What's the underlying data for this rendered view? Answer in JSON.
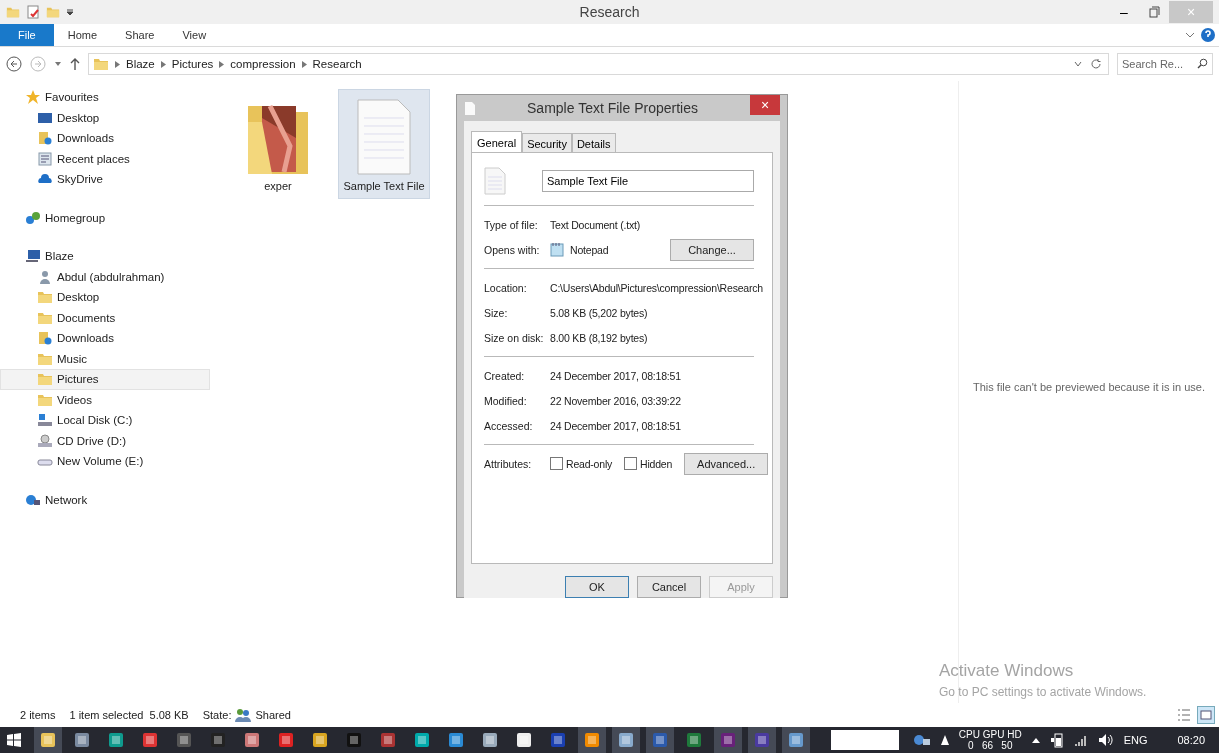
{
  "window": {
    "title": "Research",
    "controls": [
      "–",
      "×"
    ]
  },
  "ribbon": {
    "tabs": [
      {
        "label": "File",
        "selected": true
      },
      {
        "label": "Home",
        "selected": false
      },
      {
        "label": "Share",
        "selected": false
      },
      {
        "label": "View",
        "selected": false
      }
    ]
  },
  "address_bar": {
    "path": [
      "Blaze",
      "Pictures",
      "compression",
      "Research"
    ],
    "search": {
      "placeholder": "Search Re..."
    }
  },
  "sidebar": {
    "items": [
      {
        "label": "Favourites",
        "kind": "star",
        "selected": false,
        "children": [
          {
            "label": "Desktop",
            "kind": "desktop",
            "selected": false
          },
          {
            "label": "Downloads",
            "kind": "downloads",
            "selected": false
          },
          {
            "label": "Recent places",
            "kind": "recent",
            "selected": false
          },
          {
            "label": "SkyDrive",
            "kind": "cloud",
            "selected": false
          }
        ]
      },
      {
        "label": "Homegroup",
        "kind": "homegroup",
        "selected": false
      },
      {
        "label": "Blaze",
        "kind": "computer",
        "selected": false,
        "children": [
          {
            "label": "Abdul (abdulrahman)",
            "kind": "user",
            "selected": false
          },
          {
            "label": "Desktop",
            "kind": "folder",
            "selected": false
          },
          {
            "label": "Documents",
            "kind": "folder",
            "selected": false
          },
          {
            "label": "Downloads",
            "kind": "downloads",
            "selected": false
          },
          {
            "label": "Music",
            "kind": "folder",
            "selected": false
          },
          {
            "label": "Pictures",
            "kind": "folder",
            "selected": true
          },
          {
            "label": "Videos",
            "kind": "folder",
            "selected": false
          },
          {
            "label": "Local Disk (C:)",
            "kind": "disk",
            "selected": false
          },
          {
            "label": "CD Drive (D:)",
            "kind": "cd",
            "selected": false
          },
          {
            "label": "New Volume (E:)",
            "kind": "drive",
            "selected": false
          }
        ]
      },
      {
        "label": "Network",
        "kind": "network",
        "selected": false
      }
    ]
  },
  "files": [
    {
      "name": "exper",
      "kind": "folder",
      "selected": false
    },
    {
      "name": "Sample Text File",
      "kind": "text",
      "selected": true
    }
  ],
  "preview": {
    "message": "This file can't be previewed because it is in use."
  },
  "dialog": {
    "title": "Sample Text File Properties",
    "close": "×",
    "tabs": [
      {
        "label": "General",
        "selected": true
      },
      {
        "label": "Security",
        "selected": false
      },
      {
        "label": "Details",
        "selected": false
      }
    ],
    "name": "Sample Text File",
    "sections": [
      [
        {
          "label": "Type of file:",
          "kind": "text",
          "value": "Text Document (.txt)"
        },
        {
          "label": "Opens with:",
          "kind": "app",
          "value": "Notepad",
          "button": "Change..."
        }
      ],
      [
        {
          "label": "Location:",
          "kind": "text",
          "value": "C:\\Users\\Abdul\\Pictures\\compression\\Research"
        },
        {
          "label": "Size:",
          "kind": "text",
          "value": "5.08 KB (5,202 bytes)"
        },
        {
          "label": "Size on disk:",
          "kind": "text",
          "value": "8.00 KB (8,192 bytes)"
        }
      ],
      [
        {
          "label": "Created:",
          "kind": "text",
          "value": "24 December 2017, 08:18:51"
        },
        {
          "label": "Modified:",
          "kind": "text",
          "value": "22 November 2016, 03:39:22"
        },
        {
          "label": "Accessed:",
          "kind": "text",
          "value": "24 December 2017, 08:18:51"
        }
      ],
      [
        {
          "label": "Attributes:",
          "kind": "attributes",
          "checkboxes": [
            {
              "label": "Read-only",
              "checked": false
            },
            {
              "label": "Hidden",
              "checked": false
            }
          ],
          "button": "Advanced..."
        }
      ]
    ],
    "buttons": [
      {
        "label": "OK",
        "disabled": false,
        "default": true
      },
      {
        "label": "Cancel",
        "disabled": false,
        "default": false
      },
      {
        "label": "Apply",
        "disabled": true,
        "default": false
      }
    ]
  },
  "activation": {
    "title": "Activate Windows",
    "message": "Go to PC settings to activate Windows."
  },
  "status_bar": {
    "items": "2 items",
    "selection": "1 item selected  5.08 KB",
    "state_label": "State:",
    "state": "Shared"
  },
  "taskbar": {
    "apps": [
      {
        "kind": "explorer",
        "running": true
      },
      {
        "kind": "tool",
        "running": false
      },
      {
        "kind": "teal",
        "running": false
      },
      {
        "kind": "blocks",
        "running": false
      },
      {
        "kind": "arrows",
        "running": false
      },
      {
        "kind": "archive",
        "running": false
      },
      {
        "kind": "brain",
        "running": false
      },
      {
        "kind": "red",
        "running": false
      },
      {
        "kind": "gold",
        "running": false
      },
      {
        "kind": "console",
        "running": false
      },
      {
        "kind": "gem",
        "running": false
      },
      {
        "kind": "loop",
        "running": false
      },
      {
        "kind": "player",
        "running": false
      },
      {
        "kind": "window",
        "running": false
      },
      {
        "kind": "page",
        "running": false
      },
      {
        "kind": "blue",
        "running": false
      },
      {
        "kind": "cone",
        "running": true
      },
      {
        "kind": "notepad",
        "running": true
      },
      {
        "kind": "word",
        "running": true
      },
      {
        "kind": "sheet",
        "running": false
      },
      {
        "kind": "studio",
        "running": true
      },
      {
        "kind": "wizard",
        "running": true
      },
      {
        "kind": "calculator",
        "running": true
      }
    ],
    "monitor": {
      "header": "CPU GPU HD",
      "values": "0   66   50"
    },
    "language": "ENG",
    "clock": "08:20"
  }
}
